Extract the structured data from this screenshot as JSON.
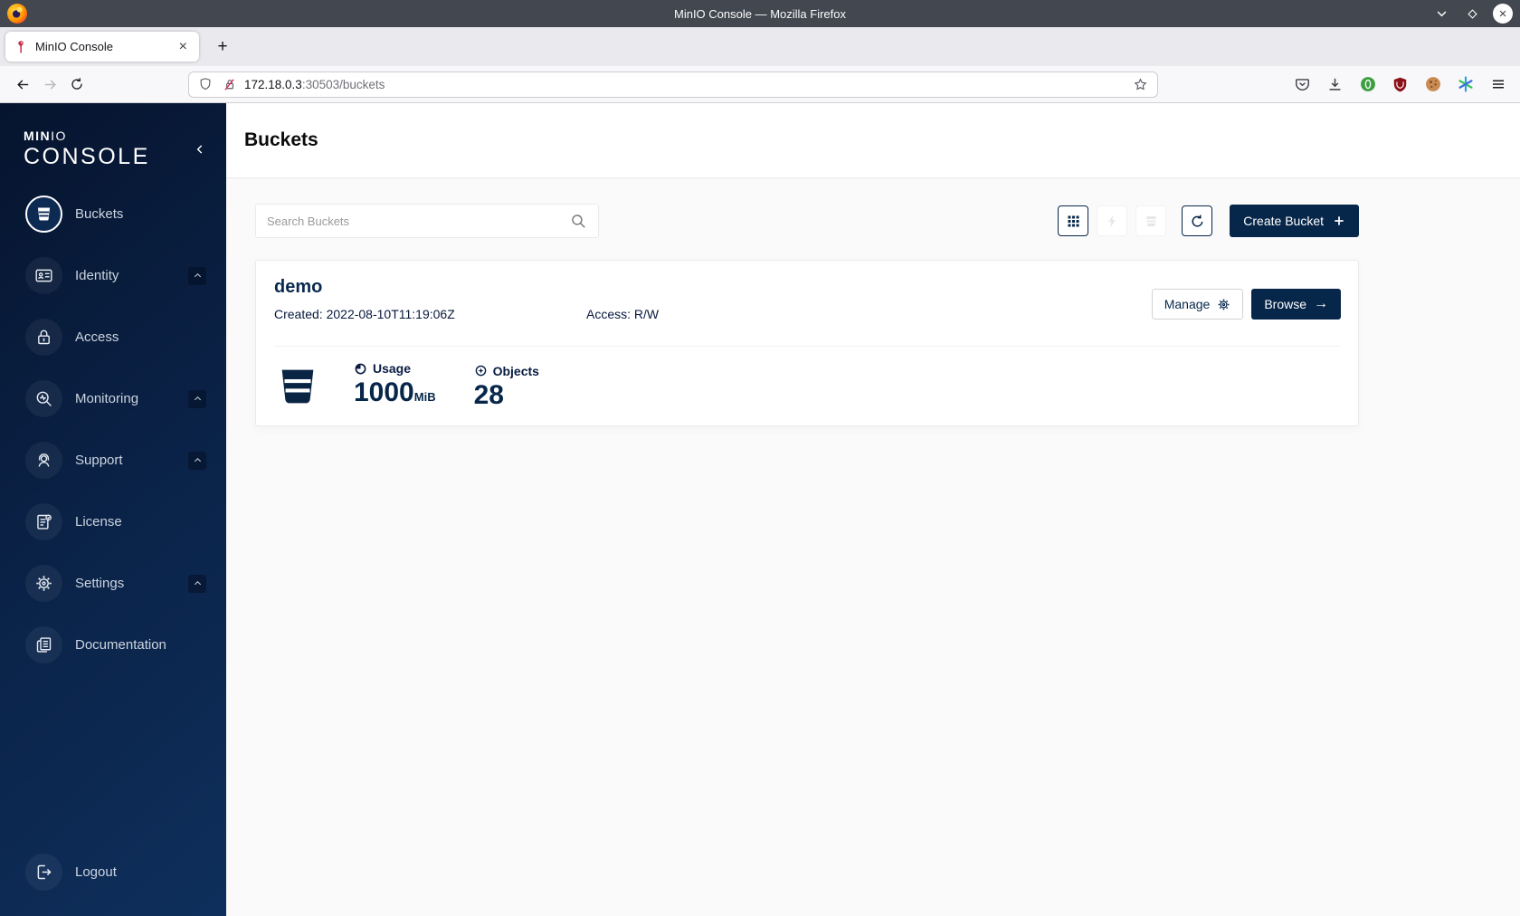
{
  "browser": {
    "window_title": "MinIO Console — Mozilla Firefox",
    "tab_title": "MinIO Console",
    "url": {
      "host": "172.18.0.3",
      "rest": ":30503/buckets"
    }
  },
  "icons_text": {
    "new_tab": "+",
    "tab_close": "×",
    "window_close": "×",
    "browse_arrow": "→"
  },
  "sidebar": {
    "logo": {
      "min": "MIN",
      "io": "IO",
      "console": "CONSOLE"
    },
    "items": [
      {
        "label": "Buckets"
      },
      {
        "label": "Identity"
      },
      {
        "label": "Access"
      },
      {
        "label": "Monitoring"
      },
      {
        "label": "Support"
      },
      {
        "label": "License"
      },
      {
        "label": "Settings"
      },
      {
        "label": "Documentation"
      }
    ],
    "logout": "Logout"
  },
  "page": {
    "title": "Buckets",
    "search_placeholder": "Search Buckets",
    "create_button": "Create Bucket"
  },
  "bucket": {
    "name": "demo",
    "created": "Created: 2022-08-10T11:19:06Z",
    "access": "Access: R/W",
    "manage": "Manage",
    "browse": "Browse",
    "usage_label": "Usage",
    "usage_value": "1000",
    "usage_unit": "MiB",
    "objects_label": "Objects",
    "objects_value": "28"
  },
  "colors": {
    "primary_navy": "#07274a",
    "sidebar_gradient_start": "#06142e",
    "sidebar_gradient_end": "#0e2f5c",
    "content_bg": "#fafafa",
    "minio_red": "#c72c49",
    "insecure_red": "#e22850"
  }
}
